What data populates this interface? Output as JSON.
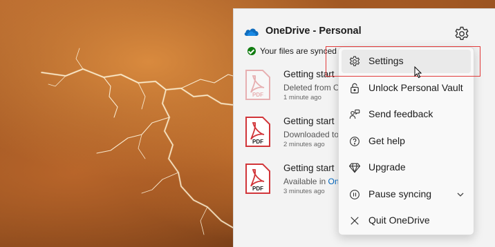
{
  "app": {
    "title": "OneDrive - Personal",
    "status": "Your files are synced"
  },
  "files": [
    {
      "name": "Getting start",
      "desc": "Deleted from O",
      "time": "1 minute ago",
      "icon": "pdf-icon-faded"
    },
    {
      "name": "Getting start",
      "desc": "Downloaded to",
      "time": "2 minutes ago",
      "icon": "pdf-icon"
    },
    {
      "name": "Getting start",
      "desc_prefix": "Available in ",
      "desc_link": "On",
      "time": "3 minutes ago",
      "icon": "pdf-icon"
    }
  ],
  "menu": {
    "items": [
      {
        "label": "Settings",
        "icon": "gear-icon"
      },
      {
        "label": "Unlock Personal Vault",
        "icon": "lock-icon"
      },
      {
        "label": "Send feedback",
        "icon": "feedback-icon"
      },
      {
        "label": "Get help",
        "icon": "help-icon"
      },
      {
        "label": "Upgrade",
        "icon": "diamond-icon"
      },
      {
        "label": "Pause syncing",
        "icon": "pause-icon"
      },
      {
        "label": "Quit OneDrive",
        "icon": "close-icon"
      }
    ]
  },
  "colors": {
    "accent": "#0067c0",
    "pdf_red": "#d13438",
    "success": "#107c10",
    "highlight": "#e23a3a"
  }
}
